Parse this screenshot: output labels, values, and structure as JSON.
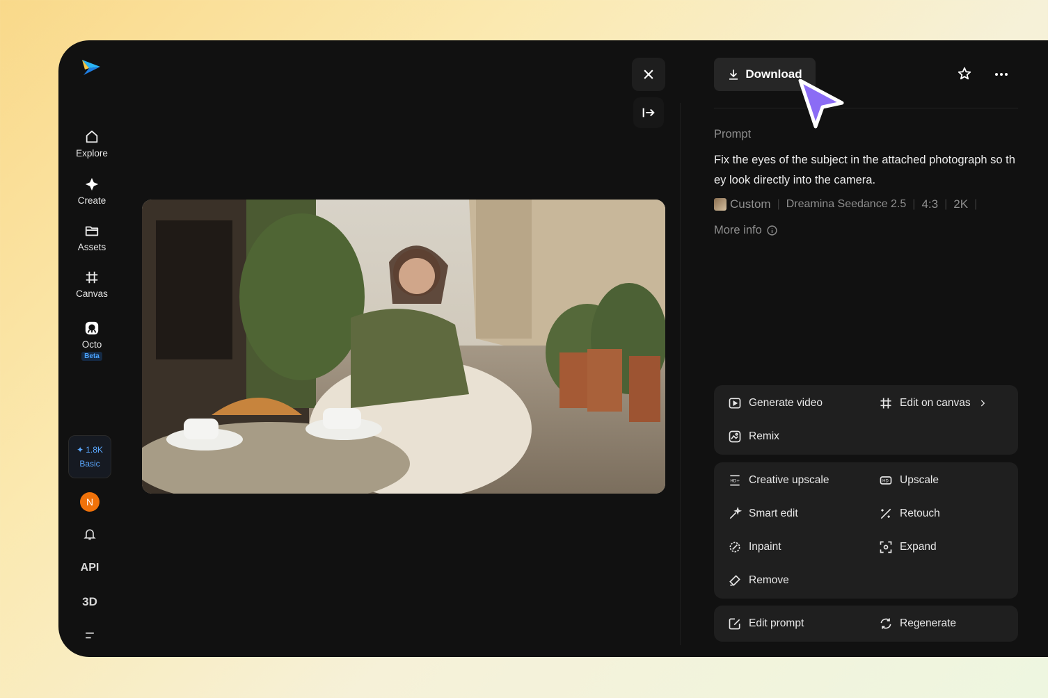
{
  "sidebar": {
    "items": [
      {
        "label": "Explore",
        "icon": "home-icon"
      },
      {
        "label": "Create",
        "icon": "sparkle-icon"
      },
      {
        "label": "Assets",
        "icon": "folder-icon"
      },
      {
        "label": "Canvas",
        "icon": "canvas-grid-icon"
      },
      {
        "label": "Octo",
        "icon": "octo-icon",
        "badge": "Beta"
      }
    ],
    "credits": {
      "amount": "1.8K",
      "plan": "Basic"
    },
    "avatar_initial": "N",
    "api_label": "API",
    "three_d_label": "3D"
  },
  "viewer": {
    "close_icon": "close-icon",
    "collapse_icon": "arrow-to-right-icon"
  },
  "panel": {
    "download_label": "Download",
    "prompt_label": "Prompt",
    "prompt_text": "Fix the eyes of the subject in the attached photograph so they look directly into the camera.",
    "meta": {
      "custom": "Custom",
      "model": "Dreamina Seedance 2.5",
      "ratio": "4:3",
      "resolution": "2K"
    },
    "more_info": "More info",
    "actions_group1": {
      "generate_video": "Generate video",
      "edit_on_canvas": "Edit on canvas",
      "remix": "Remix"
    },
    "actions_group2": {
      "creative_upscale": "Creative upscale",
      "upscale": "Upscale",
      "smart_edit": "Smart edit",
      "retouch": "Retouch",
      "inpaint": "Inpaint",
      "expand": "Expand",
      "remove": "Remove"
    },
    "actions_group3": {
      "edit_prompt": "Edit prompt",
      "regenerate": "Regenerate"
    }
  },
  "colors": {
    "app_bg": "#111111",
    "card_bg": "#1f1f1f",
    "accent_blue": "#4aa3ff",
    "avatar_orange": "#f0720a",
    "cursor_purple": "#8b6cf5"
  }
}
